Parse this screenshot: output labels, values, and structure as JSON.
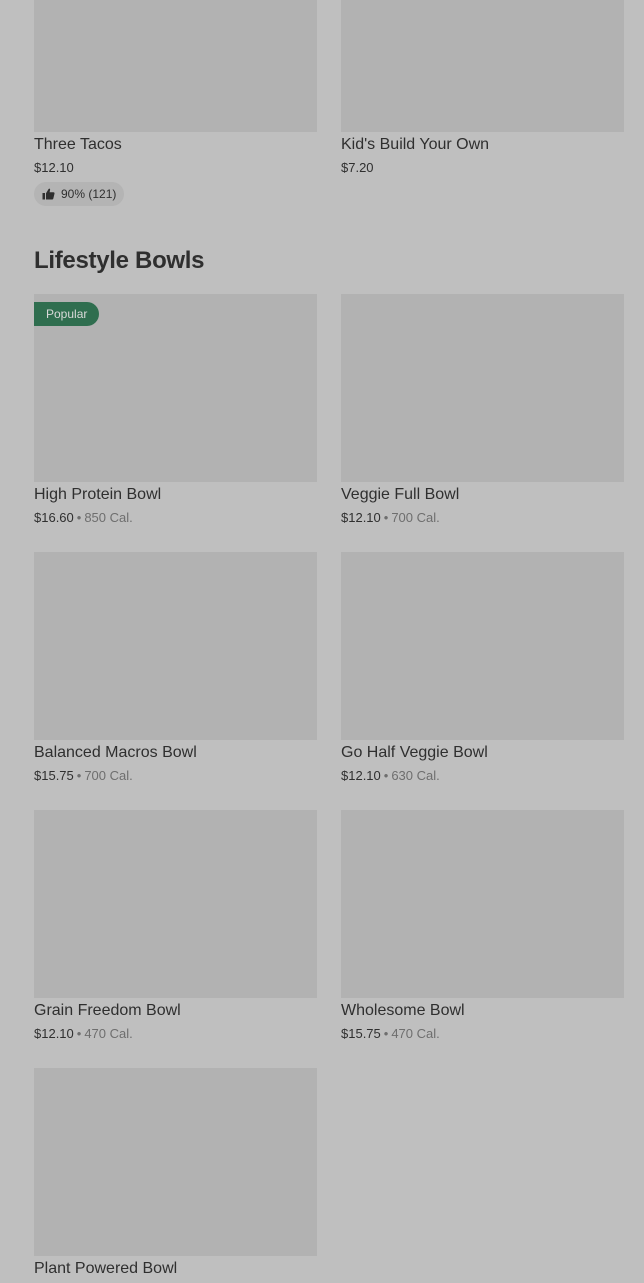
{
  "top_items": [
    {
      "name": "Three Tacos",
      "price": "$12.10",
      "rating": "90% (121)"
    },
    {
      "name": "Kid's Build Your Own",
      "price": "$7.20"
    }
  ],
  "section": {
    "title": "Lifestyle Bowls",
    "popular_badge": "Popular",
    "separator": "•",
    "items": [
      {
        "name": "High Protein Bowl",
        "price": "$16.60",
        "calories": "850 Cal."
      },
      {
        "name": "Veggie Full Bowl",
        "price": "$12.10",
        "calories": "700 Cal."
      },
      {
        "name": "Balanced Macros Bowl",
        "price": "$15.75",
        "calories": "700 Cal."
      },
      {
        "name": "Go Half Veggie Bowl",
        "price": "$12.10",
        "calories": "630 Cal."
      },
      {
        "name": "Grain Freedom Bowl",
        "price": "$12.10",
        "calories": "470 Cal."
      },
      {
        "name": "Wholesome Bowl",
        "price": "$15.75",
        "calories": "470 Cal."
      },
      {
        "name": "Plant Powered Bowl"
      }
    ]
  }
}
